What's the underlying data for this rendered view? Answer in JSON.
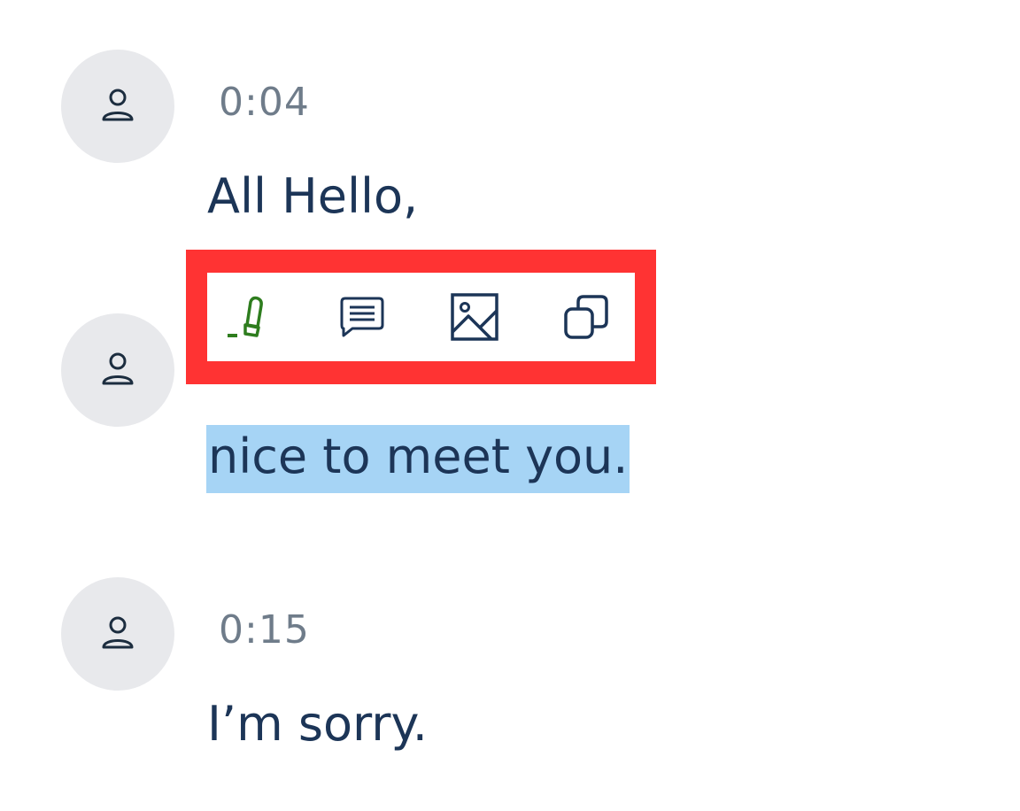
{
  "colors": {
    "text": "#1c3557",
    "timestamp": "#6f7c8a",
    "avatar_bg": "#e8e9ec",
    "highlight_bg": "#a6d4f5",
    "highlighter_green": "#2e7d1e",
    "focus_frame": "#ff3333"
  },
  "messages": [
    {
      "timestamp": "0:04",
      "text": "All Hello,"
    },
    {
      "text": "nice to meet you."
    },
    {
      "timestamp": "0:15",
      "text": "I’m sorry."
    }
  ],
  "toolbar": {
    "items": [
      {
        "icon": "highlighter-icon"
      },
      {
        "icon": "comment-icon"
      },
      {
        "icon": "image-icon"
      },
      {
        "icon": "copy-icon"
      }
    ]
  }
}
